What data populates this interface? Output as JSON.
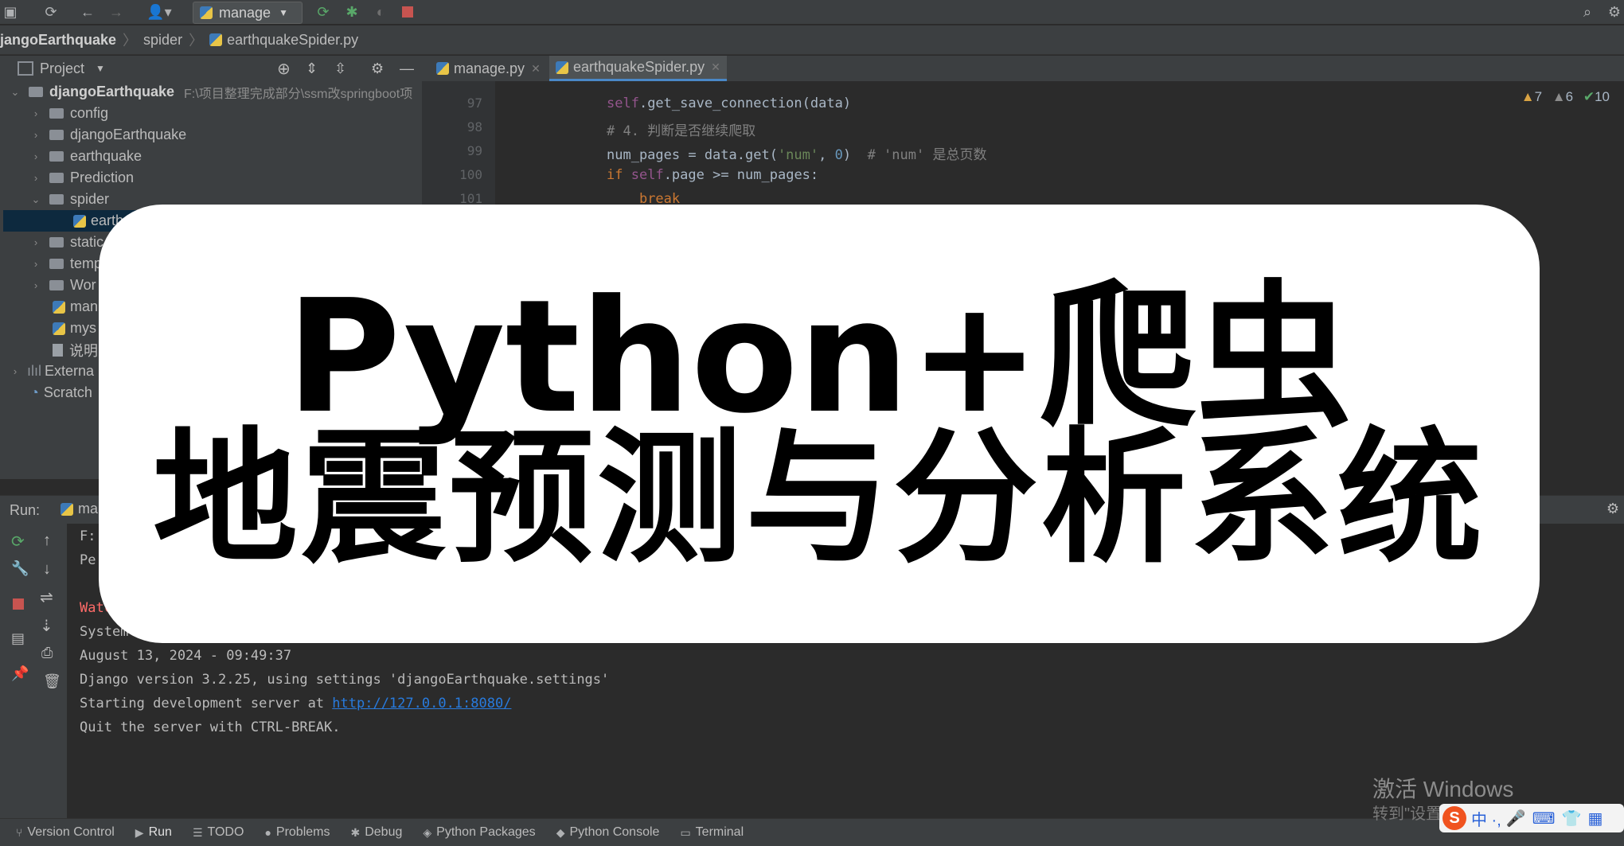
{
  "toolbar": {
    "run_config": "manage"
  },
  "breadcrumb": [
    "jangoEarthquake",
    "spider",
    "earthquakeSpider.py"
  ],
  "project": {
    "header": "Project",
    "root_name": "djangoEarthquake",
    "root_path": "F:\\项目整理完成部分\\ssm改springboot项",
    "items": [
      {
        "label": "config",
        "kind": "folder"
      },
      {
        "label": "djangoEarthquake",
        "kind": "folder"
      },
      {
        "label": "earthquake",
        "kind": "folder"
      },
      {
        "label": "Prediction",
        "kind": "folder"
      },
      {
        "label": "spider",
        "kind": "folder"
      },
      {
        "label": "earthq",
        "kind": "pyfile"
      },
      {
        "label": "static",
        "kind": "folder"
      },
      {
        "label": "temp",
        "kind": "folder"
      },
      {
        "label": "Wor",
        "kind": "folder"
      },
      {
        "label": "man",
        "kind": "pyfile"
      },
      {
        "label": "mys",
        "kind": "pyfile"
      },
      {
        "label": "说明",
        "kind": "file"
      },
      {
        "label": "Externa",
        "kind": "lib"
      },
      {
        "label": "Scratch",
        "kind": "scratch"
      }
    ]
  },
  "editor": {
    "tabs": [
      "manage.py",
      "earthquakeSpider.py"
    ],
    "inspections": {
      "warnings": "7",
      "weak": "6",
      "ok": "10"
    },
    "lines": [
      {
        "num": "97",
        "code": "self.get_save_connection(data)"
      },
      {
        "num": "98",
        "code": "# 4. 判断是否继续爬取"
      },
      {
        "num": "99",
        "code": "num_pages = data.get('num', 0)  # 'num' 是总页数"
      },
      {
        "num": "100",
        "code": "if self.page >= num_pages:"
      },
      {
        "num": "101",
        "code": "    break"
      }
    ]
  },
  "run": {
    "label": "Run:",
    "tab": "ma",
    "console": [
      "F:",
      "Pe",
      "",
      "Watc",
      "System c",
      "August 13, 2024 - 09:49:37",
      "Django version 3.2.25, using settings 'djangoEarthquake.settings'",
      "Starting development server at ",
      "Quit the server with CTRL-BREAK."
    ],
    "server_url": "http://127.0.0.1:8080/"
  },
  "statusbar": [
    {
      "label": "Version Control",
      "icon": "branch-icon"
    },
    {
      "label": "Run",
      "icon": "play-icon"
    },
    {
      "label": "TODO",
      "icon": "list-icon"
    },
    {
      "label": "Problems",
      "icon": "info-icon"
    },
    {
      "label": "Debug",
      "icon": "bug-icon"
    },
    {
      "label": "Python Packages",
      "icon": "layers-icon"
    },
    {
      "label": "Python Console",
      "icon": "python-icon"
    },
    {
      "label": "Terminal",
      "icon": "terminal-icon"
    }
  ],
  "overlay": {
    "line1": "Python+爬虫",
    "line2": "地震预测与分析系统"
  },
  "watermark": {
    "line1": "激活 Windows",
    "line2": "转到\"设置\"以激活 Windows。"
  },
  "ime": {
    "chars": "中 ·, "
  }
}
